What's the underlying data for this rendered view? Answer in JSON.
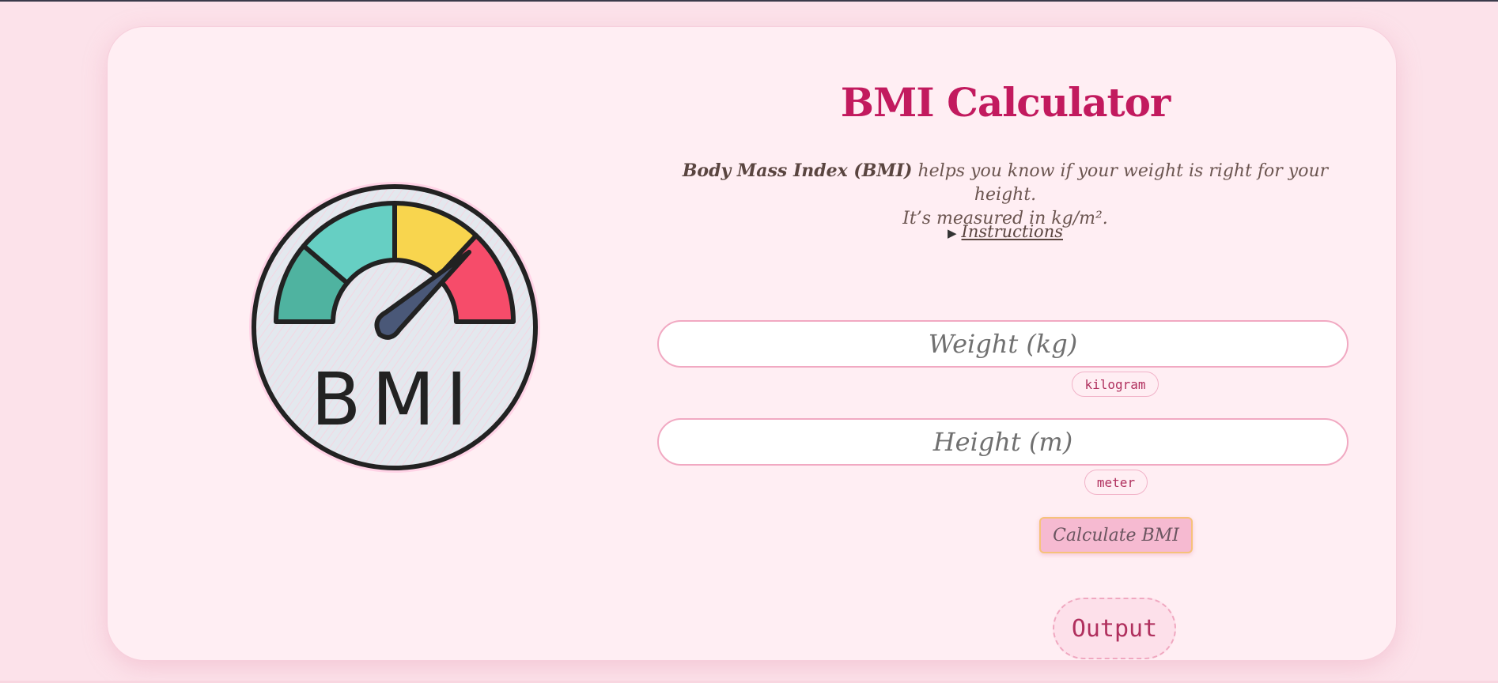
{
  "header": {
    "title": "BMI Calculator"
  },
  "description": {
    "lead_bold": "Body Mass Index (BMI)",
    "line1_rest": " helps you know if your weight is right for your height.",
    "line2": "It’s measured in kg/m²."
  },
  "instructions": {
    "marker": "▶",
    "label": "Instructions"
  },
  "logo": {
    "text": "BMI"
  },
  "form": {
    "weight_placeholder": "Weight (kg)",
    "weight_unit": "kilogram",
    "height_placeholder": "Height (m)",
    "height_unit": "meter",
    "calculate_label": "Calculate BMI"
  },
  "output": {
    "label": "Output"
  },
  "colors": {
    "accent": "#c21a5e",
    "background": "#fce2ea",
    "card": "#ffeef3",
    "gauge_green_dark": "#4fb3a0",
    "gauge_teal": "#66cfc3",
    "gauge_yellow": "#f8d54e",
    "gauge_red": "#f64c6a",
    "needle": "#4a5878"
  }
}
